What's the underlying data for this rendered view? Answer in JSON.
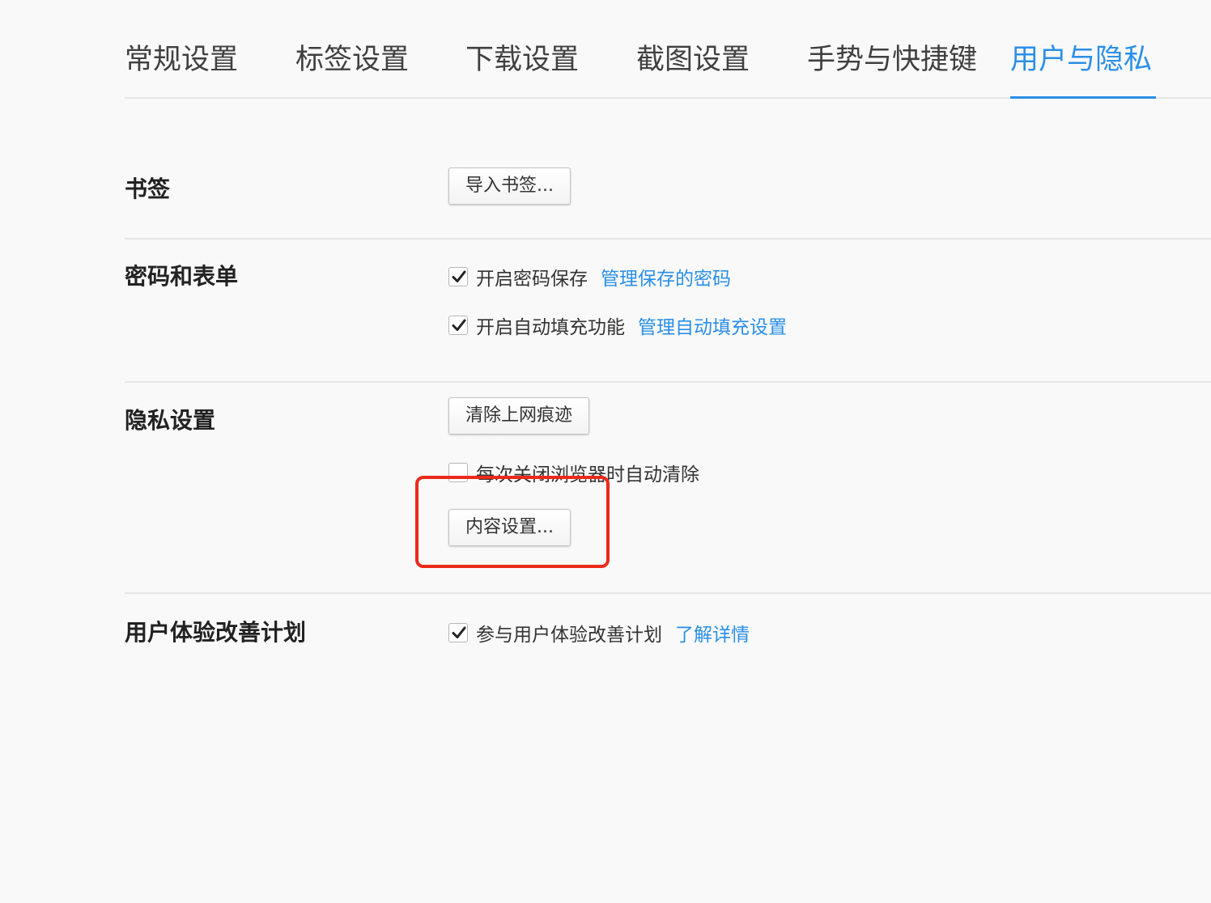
{
  "tabs": [
    {
      "label": "常规设置"
    },
    {
      "label": "标签设置"
    },
    {
      "label": "下载设置"
    },
    {
      "label": "截图设置"
    },
    {
      "label": "手势与快捷键"
    },
    {
      "label": "用户与隐私",
      "active": true
    }
  ],
  "bookmarks": {
    "label": "书签",
    "import_button": "导入书签..."
  },
  "passwords": {
    "label": "密码和表单",
    "save_password": {
      "label": "开启密码保存",
      "checked": true,
      "link": "管理保存的密码"
    },
    "autofill": {
      "label": "开启自动填充功能",
      "checked": true,
      "link": "管理自动填充设置"
    }
  },
  "privacy": {
    "label": "隐私设置",
    "clear_button": "清除上网痕迹",
    "auto_clear": {
      "label": "每次关闭浏览器时自动清除",
      "checked": false
    },
    "content_button": "内容设置..."
  },
  "ux_program": {
    "label": "用户体验改善计划",
    "participate": {
      "label": "参与用户体验改善计划",
      "checked": true,
      "link": "了解详情"
    }
  },
  "colors": {
    "accent": "#2a8fe8",
    "highlight": "#ec2a1b",
    "background": "#f9f9f9"
  }
}
